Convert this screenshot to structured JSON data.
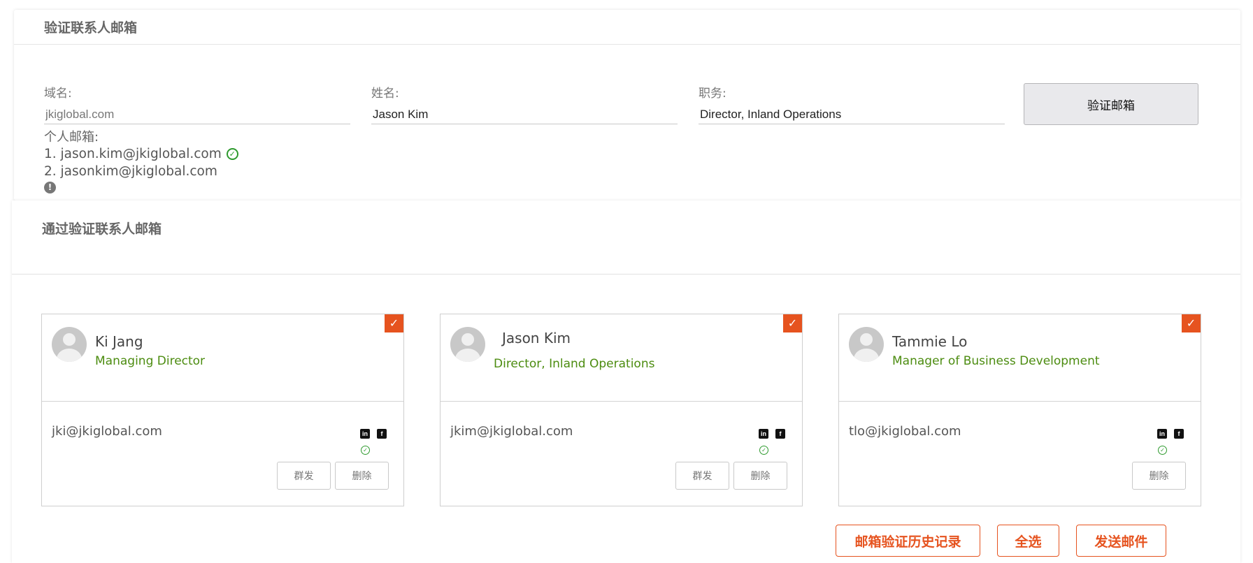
{
  "verify_panel": {
    "title": "验证联系人邮箱",
    "domain_label": "域名:",
    "domain_placeholder": "jkiglobal.com",
    "name_label": "姓名:",
    "name_value": "Jason Kim",
    "position_label": "职务:",
    "position_value": "Director, Inland Operations",
    "verify_button": "验证邮箱",
    "personal_email_label": "个人邮箱:",
    "personal_emails": [
      "1. jason.kim@jkiglobal.com",
      "2. jasonkim@jkiglobal.com"
    ]
  },
  "verified_panel": {
    "title": "通过验证联系人邮箱",
    "contacts": [
      {
        "name": "Ki Jang",
        "title": "Managing Director",
        "email": "jki@jkiglobal.com",
        "buttons": [
          "群发",
          "删除"
        ]
      },
      {
        "name": "Jason Kim",
        "title": "Director, Inland Operations",
        "email": "jkim@jkiglobal.com",
        "buttons": [
          "群发",
          "删除"
        ]
      },
      {
        "name": "Tammie Lo",
        "title": "Manager of Business Development",
        "email": "tlo@jkiglobal.com",
        "buttons": [
          "删除"
        ]
      }
    ],
    "actions": {
      "history": "邮箱验证历史记录",
      "select_all": "全选",
      "send": "发送邮件"
    }
  },
  "icons": {
    "verified": "check-circle-icon",
    "warning": "exclamation-circle-icon",
    "selected": "checkbox-checked-icon",
    "linkedin": "linkedin-icon",
    "facebook": "facebook-icon",
    "avatar": "user-avatar-icon"
  },
  "colors": {
    "accent": "#e6531f",
    "title_green": "#4c8c10",
    "verified_green": "#2e9a2e"
  }
}
